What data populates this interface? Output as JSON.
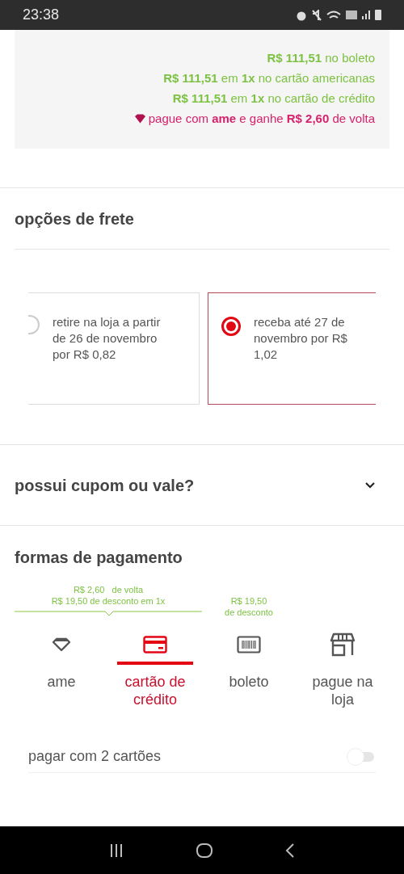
{
  "status_bar": {
    "time": "23:38"
  },
  "price_lines": [
    {
      "kind": "price",
      "text": "**R$ 111,51** no boleto"
    },
    {
      "kind": "price",
      "text": "**R$ 111,51** em **1x** no cartão americanas"
    },
    {
      "kind": "price",
      "text": "**R$ 111,51** em **1x** no cartão de crédito"
    },
    {
      "kind": "cashback",
      "text": "pague com **ame** e ganhe **R$ 2,60** de volta"
    }
  ],
  "shipping": {
    "title": "opções de frete",
    "options": [
      {
        "text": "retire na loja a partir de 26 de novembro por R$ 0,82",
        "selected": false
      },
      {
        "text": "receba até 27 de novembro por R$ 1,02",
        "selected": true
      }
    ]
  },
  "coupon": {
    "title": "possui cupom ou vale?",
    "expanded": false
  },
  "payment": {
    "title": "formas de pagamento",
    "promos": [
      {
        "kind": "pointer",
        "lines": [
          "R$ 2,60   de volta",
          "R$ 19,50 de desconto em 1x"
        ]
      },
      {
        "kind": "plain",
        "lines": [
          "R$ 19,50",
          "de desconto"
        ]
      }
    ],
    "tabs": [
      {
        "kind": "ame",
        "label": "ame",
        "selected": false
      },
      {
        "kind": "card",
        "label": "cartão de crédito",
        "selected": true
      },
      {
        "kind": "barcode",
        "label": "boleto",
        "selected": false
      },
      {
        "kind": "store",
        "label": "pague na loja",
        "selected": false
      }
    ],
    "two_cards": {
      "label": "pagar com 2 cartões",
      "on": false
    }
  }
}
